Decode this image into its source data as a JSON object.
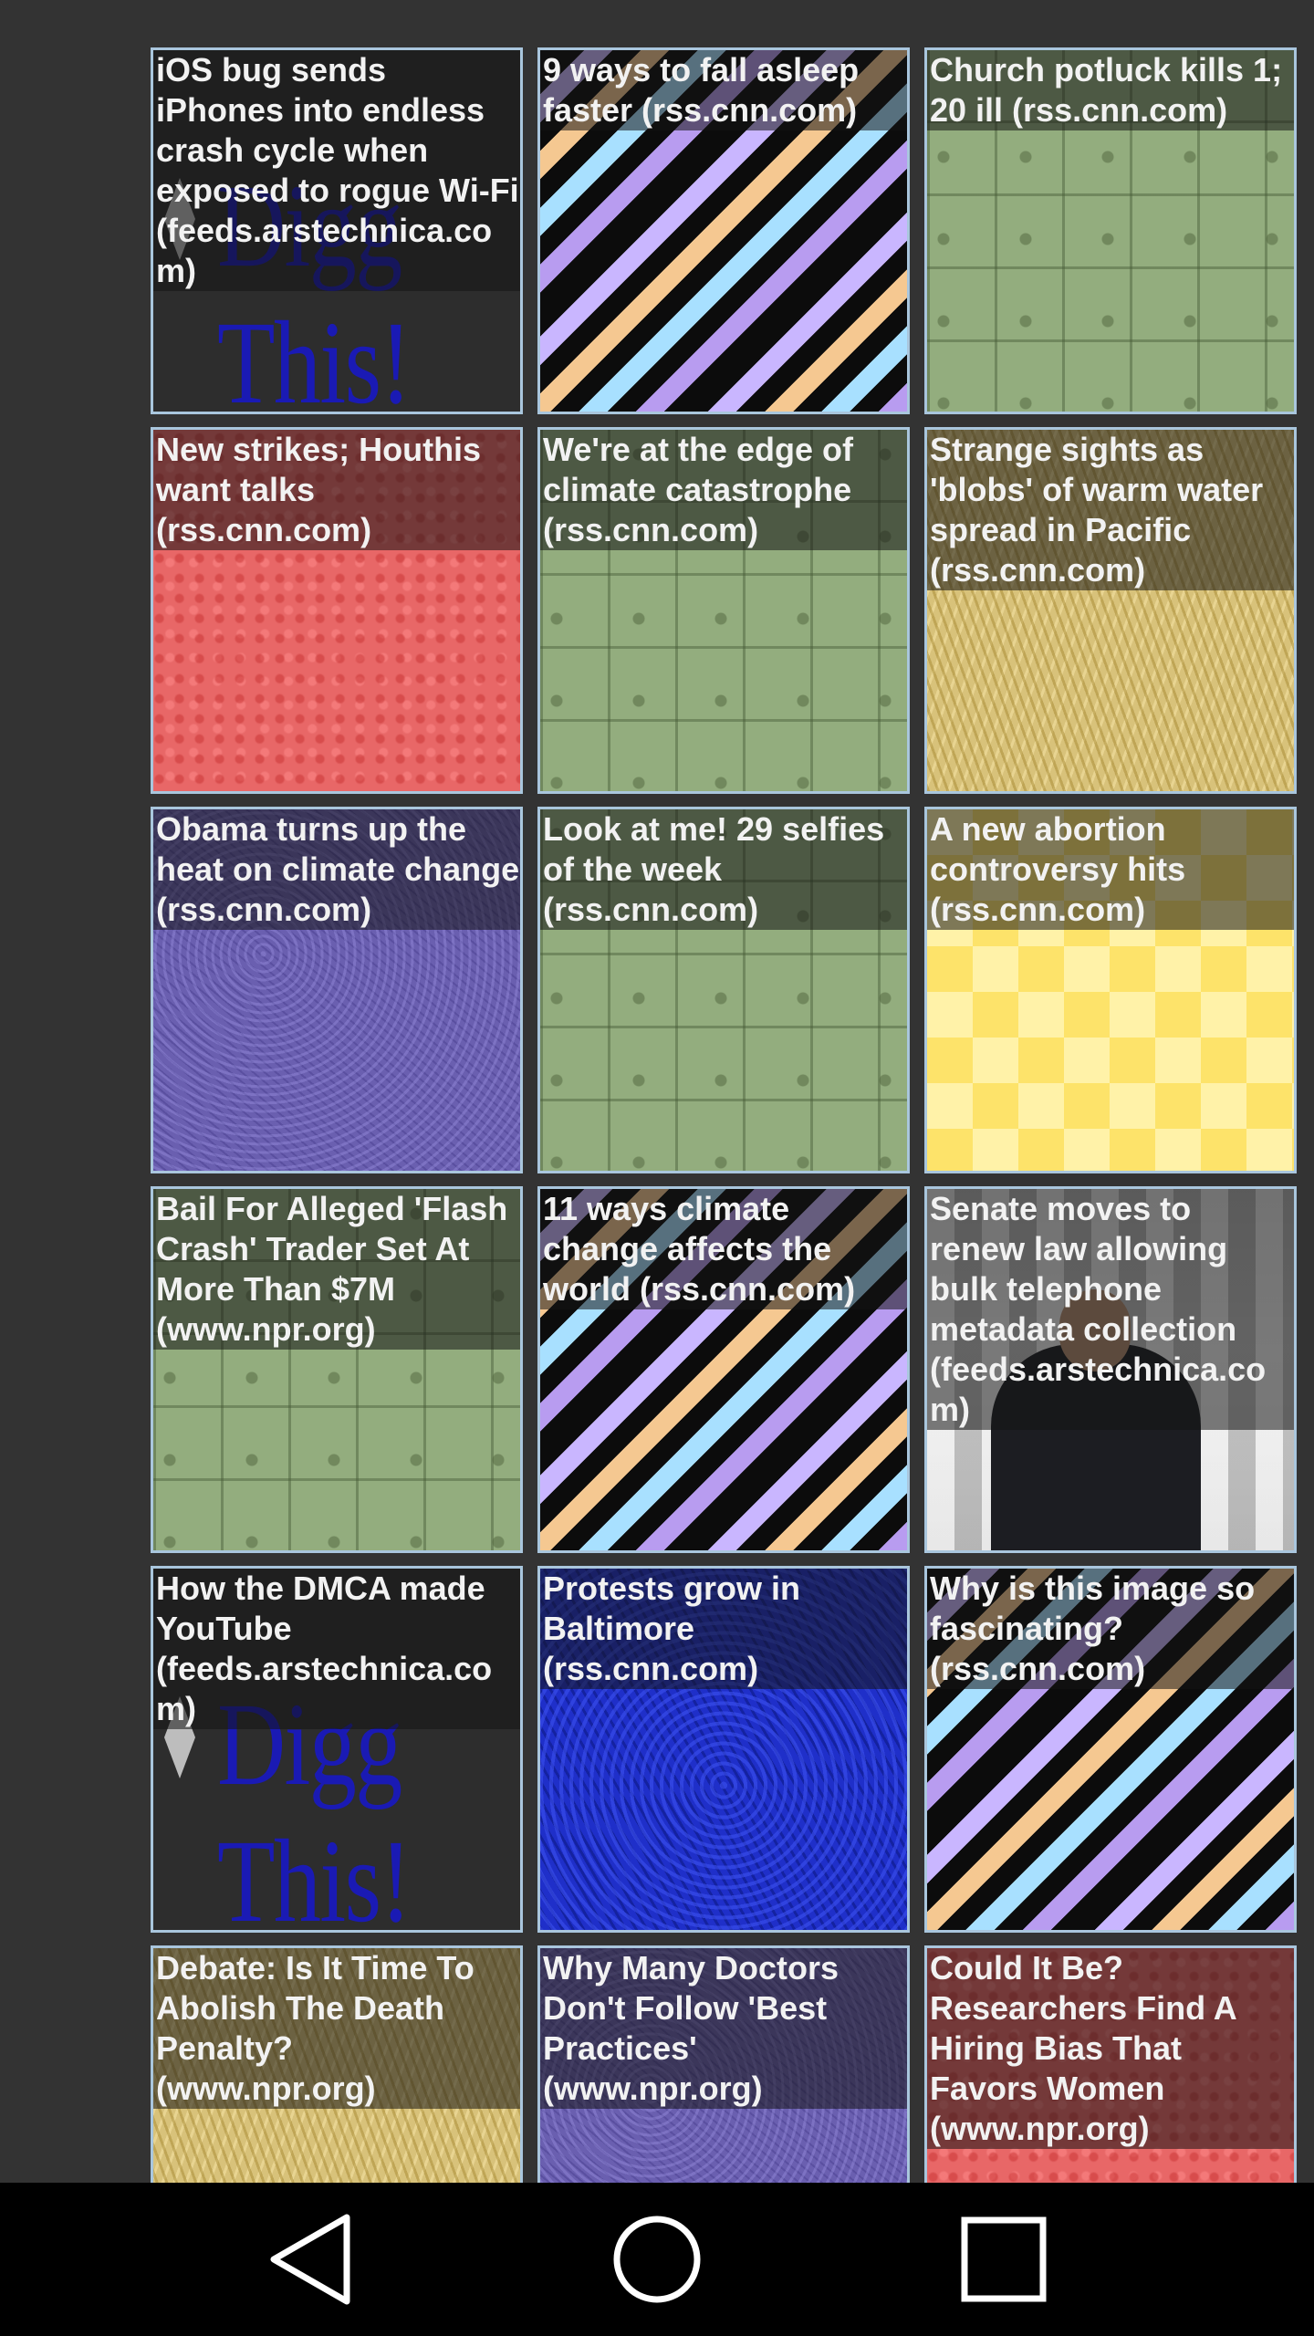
{
  "tiles": [
    {
      "title": "iOS bug sends iPhones into endless crash cycle when exposed to rogue Wi-Fi (feeds.arstechnica.com)",
      "texture": "digg",
      "digg_text": "Digg This!"
    },
    {
      "title": "9 ways to fall asleep faster (rss.cnn.com)",
      "texture": "stripes"
    },
    {
      "title": "Church potluck kills 1; 20 ill (rss.cnn.com)",
      "texture": "green"
    },
    {
      "title": "New strikes; Houthis want talks (rss.cnn.com)",
      "texture": "red"
    },
    {
      "title": "We're at the edge of climate catastrophe (rss.cnn.com)",
      "texture": "green"
    },
    {
      "title": "Strange sights as 'blobs' of warm water spread in Pacific (rss.cnn.com)",
      "texture": "gold"
    },
    {
      "title": "Obama turns up the heat on climate change (rss.cnn.com)",
      "texture": "purple"
    },
    {
      "title": "Look at me! 29 selfies of the week (rss.cnn.com)",
      "texture": "green"
    },
    {
      "title": "A new abortion controversy hits (rss.cnn.com)",
      "texture": "yellowcheck"
    },
    {
      "title": "Bail For Alleged 'Flash Crash' Trader Set At More Than $7M (www.npr.org)",
      "texture": "green"
    },
    {
      "title": "11 ways climate change affects the world (rss.cnn.com)",
      "texture": "stripes"
    },
    {
      "title": "Senate moves to renew law allowing bulk telephone metadata collection (feeds.arstechnica.com)",
      "texture": "photo"
    },
    {
      "title": "How the DMCA made YouTube (feeds.arstechnica.com)",
      "texture": "digg",
      "digg_text": "Digg This!"
    },
    {
      "title": "Protests grow in Baltimore (rss.cnn.com)",
      "texture": "blue"
    },
    {
      "title": "Why is this image so fascinating? (rss.cnn.com)",
      "texture": "stripes"
    },
    {
      "title": "Debate: Is It Time To Abolish The Death Penalty? (www.npr.org)",
      "texture": "gold"
    },
    {
      "title": "Why Many Doctors Don't Follow 'Best Practices' (www.npr.org)",
      "texture": "purple"
    },
    {
      "title": "Could It Be? Researchers Find A Hiring Bias That Favors Women (www.npr.org)",
      "texture": "red"
    }
  ],
  "navbar": {
    "back_icon": "back-triangle-icon",
    "home_icon": "home-circle-icon",
    "recents_icon": "recents-square-icon"
  }
}
